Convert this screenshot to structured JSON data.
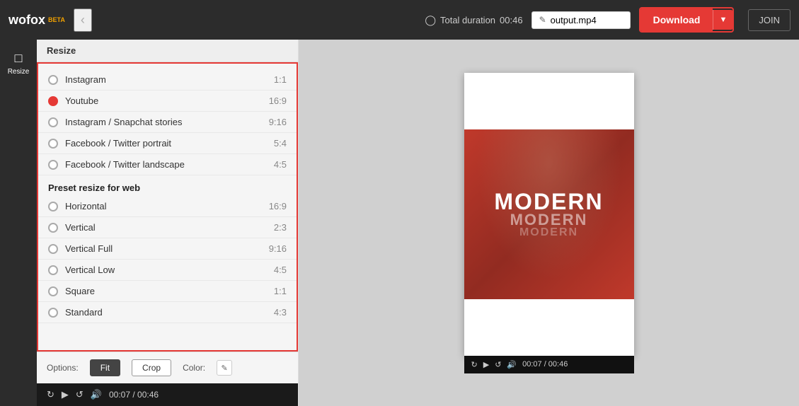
{
  "header": {
    "logo": "wofox",
    "beta": "BETA",
    "duration_label": "Total duration",
    "duration_value": "00:46",
    "filename": "output.mp4",
    "download_label": "Download",
    "join_label": "JOIN"
  },
  "sidebar": {
    "items": [
      {
        "id": "resize",
        "label": "Resize",
        "icon": "⊡"
      }
    ]
  },
  "resize_panel": {
    "title": "Resize",
    "options": [
      {
        "label": "Instagram",
        "ratio": "1:1",
        "selected": false
      },
      {
        "label": "Youtube",
        "ratio": "16:9",
        "selected": true
      },
      {
        "label": "Instagram / Snapchat stories",
        "ratio": "9:16",
        "selected": false
      },
      {
        "label": "Facebook / Twitter portrait",
        "ratio": "5:4",
        "selected": false
      },
      {
        "label": "Facebook / Twitter landscape",
        "ratio": "4:5",
        "selected": false
      }
    ],
    "web_section_title": "Preset resize for web",
    "web_options": [
      {
        "label": "Horizontal",
        "ratio": "16:9",
        "selected": false
      },
      {
        "label": "Vertical",
        "ratio": "2:3",
        "selected": false
      },
      {
        "label": "Vertical Full",
        "ratio": "9:16",
        "selected": false
      },
      {
        "label": "Vertical Low",
        "ratio": "4:5",
        "selected": false
      },
      {
        "label": "Square",
        "ratio": "1:1",
        "selected": false
      },
      {
        "label": "Standard",
        "ratio": "4:3",
        "selected": false
      }
    ],
    "options_label": "Options:",
    "fit_label": "Fit",
    "crop_label": "Crop",
    "color_label": "Color:"
  },
  "player": {
    "time_current": "00:07",
    "time_total": "00:46",
    "time_display": "00:07 / 00:46"
  },
  "preview": {
    "video_text_main": "MODERN",
    "video_text_sub": "MODERN",
    "video_text_sub2": "MODERN"
  }
}
